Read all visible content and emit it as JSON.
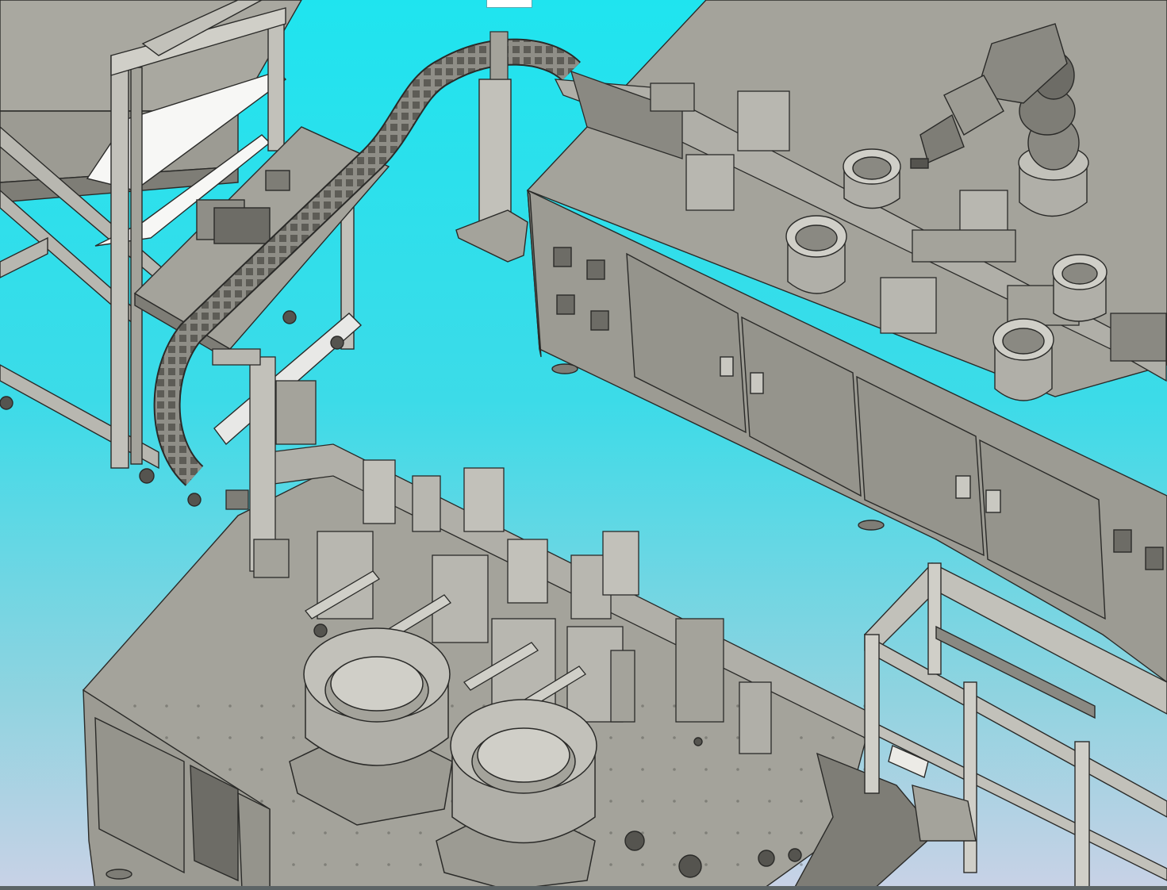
{
  "viewport": {
    "background_top": "#1fe4ef",
    "background_bottom": "#c9d2e6"
  },
  "palette": {
    "machine_body": "#9c9b93",
    "machine_top": "#a4a39b",
    "machine_dark": "#7e7d76",
    "frame_light": "#c2c1ba",
    "edge": "#2a2a28",
    "panel": "#c9c8c1"
  },
  "view_tab": {
    "label": ""
  }
}
